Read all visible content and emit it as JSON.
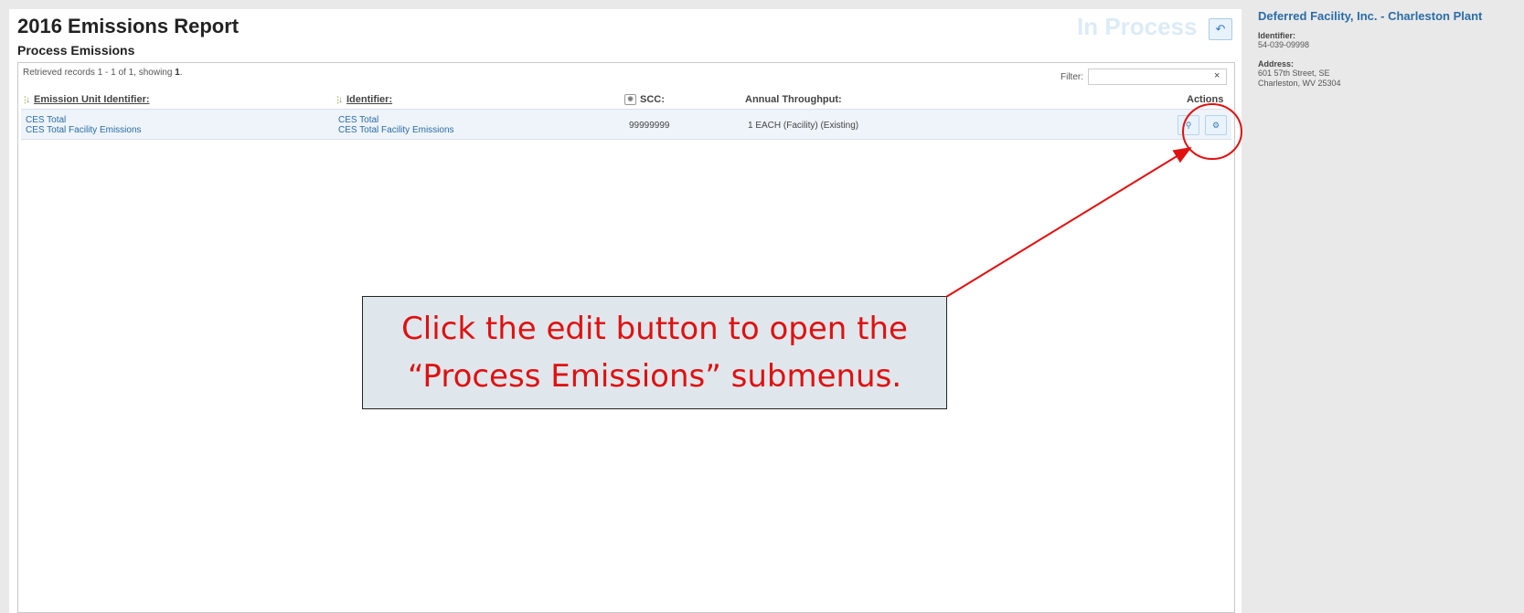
{
  "report": {
    "title": "2016 Emissions Report",
    "section": "Process Emissions",
    "status": "In Process"
  },
  "header": {
    "back_icon": "undo-icon"
  },
  "table": {
    "records_prefix": "Retrieved records 1 - 1 of 1, showing",
    "records_count": "1",
    "records_suffix": ".",
    "filter_label": "Filter:",
    "filter_value": "",
    "filter_clear": "×",
    "columns": {
      "emission_unit": "Emission Unit Identifier:",
      "identifier": "Identifier:",
      "scc": "SCC:",
      "throughput": "Annual Throughput:",
      "actions": "Actions"
    },
    "rows": [
      {
        "emission_unit_line1": "CES Total",
        "emission_unit_line2": "CES Total Facility Emissions",
        "identifier_line1": "CES Total",
        "identifier_line2": "CES Total Facility Emissions",
        "scc": "99999999",
        "throughput": "1 EACH (Facility) (Existing)"
      }
    ]
  },
  "facility": {
    "name": "Deferred Facility, Inc. - Charleston Plant",
    "identifier_label": "Identifier:",
    "identifier": "54-039-09998",
    "address_label": "Address:",
    "address_line1": "601 57th Street, SE",
    "address_line2": "Charleston, WV 25304"
  },
  "annotation": {
    "line1": "Click the edit button to open the",
    "line2": "“Process Emissions” submenus.",
    "color": "#e01010"
  }
}
